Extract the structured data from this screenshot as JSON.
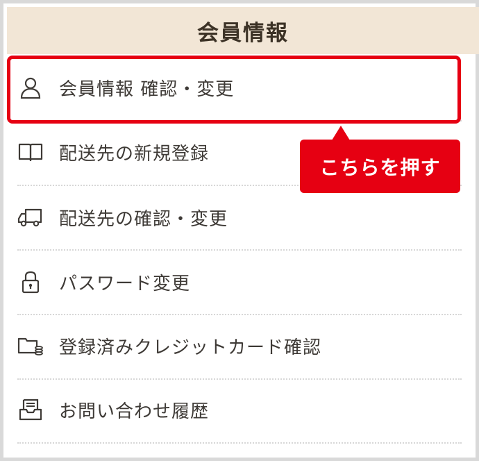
{
  "header": {
    "title": "会員情報"
  },
  "menu": [
    {
      "label": "会員情報 確認・変更",
      "icon": "person-icon"
    },
    {
      "label": "配送先の新規登録",
      "icon": "book-icon"
    },
    {
      "label": "配送先の確認・変更",
      "icon": "truck-icon"
    },
    {
      "label": "パスワード変更",
      "icon": "lock-icon"
    },
    {
      "label": "登録済みクレジットカード確認",
      "icon": "wallet-icon"
    },
    {
      "label": "お問い合わせ履歴",
      "icon": "inbox-icon"
    }
  ],
  "callout": {
    "text": "こちらを押す"
  },
  "colors": {
    "accent": "#e60012",
    "header_bg": "#f2e6d6",
    "text": "#3e3a36"
  }
}
